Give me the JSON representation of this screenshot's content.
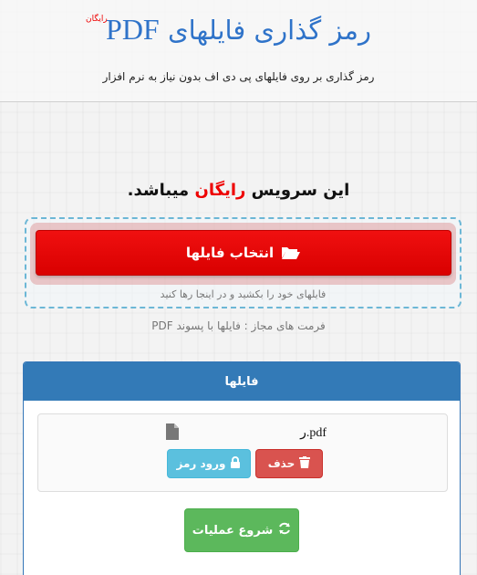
{
  "header": {
    "title_prefix": "رمز گذاری فایلهای",
    "title_pdf": "PDF",
    "free_badge": "رایگان",
    "subtitle": "رمز گذاری بر روی فایلهای پی دی اف بدون نیاز به نرم افزار"
  },
  "service": {
    "before": "این سرویس",
    "highlight": "رایگان",
    "after": "میباشد."
  },
  "upload": {
    "select_label": "انتخاب فایلها",
    "drop_hint": "فایلهای خود را بکشید و در اینجا رها کنید",
    "formats": "فرمت های مجاز : فایلها با پسوند PDF"
  },
  "files_panel": {
    "header": "فایلها",
    "file": {
      "name": "ر.pdf",
      "delete_label": "حذف",
      "password_label": "ورود رمز"
    },
    "start_label": "شروع عملیات"
  },
  "colors": {
    "title_blue": "#2f73c9",
    "red": "#e00000",
    "panel_blue": "#337ab7",
    "danger": "#d9534f",
    "info": "#5bc0de",
    "success": "#5cb85c"
  },
  "icons": [
    "folder-open-icon",
    "file-icon",
    "trash-icon",
    "lock-icon",
    "refresh-icon"
  ]
}
